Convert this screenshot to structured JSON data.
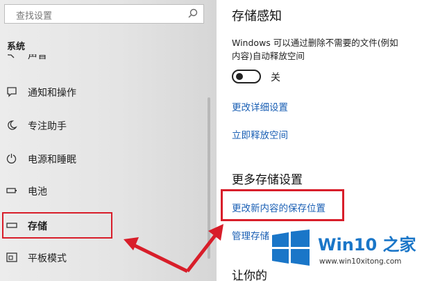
{
  "search": {
    "placeholder": "查找设置",
    "icon": "search-icon"
  },
  "sidebar": {
    "section_title": "系统",
    "cut_item_label": "声音",
    "items": [
      {
        "label": "通知和操作",
        "icon": "notification-icon"
      },
      {
        "label": "专注助手",
        "icon": "moon-icon"
      },
      {
        "label": "电源和睡眠",
        "icon": "power-icon"
      },
      {
        "label": "电池",
        "icon": "battery-icon"
      },
      {
        "label": "存储",
        "icon": "storage-icon"
      },
      {
        "label": "平板模式",
        "icon": "tablet-mode-icon"
      }
    ],
    "selected": "存储"
  },
  "content": {
    "heading": "存储感知",
    "description_line1": "Windows 可以通过删除不需要的文件(例如",
    "description_line2": "内容)自动释放空间",
    "toggle_state": "关",
    "link_change_details": "更改详细设置",
    "link_free_space": "立即释放空间",
    "section_more": "更多存储设置",
    "link_change_save_location": "更改新内容的保存位置",
    "link_manage_partial": "管理存储",
    "section_bottom_partial": "让你的"
  },
  "watermark": {
    "brand": "Win10",
    "brand_suffix": "之家",
    "url": "www.win10xitong.com"
  },
  "colors": {
    "accent": "#1a5fb4",
    "highlight": "#d81e2a",
    "brand": "#1a76c8"
  }
}
